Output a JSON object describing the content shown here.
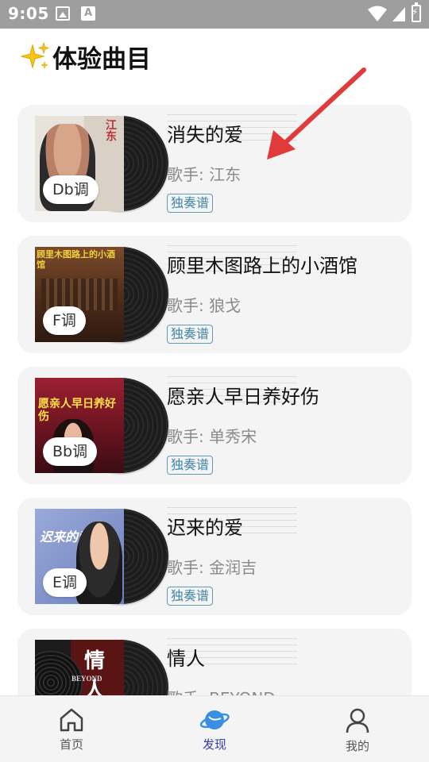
{
  "status_bar": {
    "time": "9:05",
    "a_icon": "A"
  },
  "header": {
    "title": "体验曲目",
    "icon": "sparkle-icon"
  },
  "songs": [
    {
      "title": "消失的爱",
      "artist": "歌手: 江东",
      "key": "Db调",
      "tag": "独奏谱",
      "cover": {
        "bg": "#e8e4dc",
        "text": "江东",
        "text_color": "#b33"
      }
    },
    {
      "title": "顾里木图路上的小酒馆",
      "artist": "歌手: 狼戈",
      "key": "F调",
      "tag": "独奏谱",
      "cover": {
        "bg": "#6b3b22",
        "text": "顾里木图路上的小酒馆",
        "text_color": "#f2d03b"
      }
    },
    {
      "title": "愿亲人早日养好伤",
      "artist": "歌手: 单秀宋",
      "key": "Bb调",
      "tag": "独奏谱",
      "cover": {
        "bg": "#8a1f2a",
        "text": "愿亲人早日养好伤",
        "text_color": "#ffe04a"
      }
    },
    {
      "title": "迟来的爱",
      "artist": "歌手: 金润吉",
      "key": "E调",
      "tag": "独奏谱",
      "cover": {
        "bg": "#7b8fc7",
        "text": "迟来的爱",
        "text_color": "#ffffff"
      }
    },
    {
      "title": "情人",
      "artist": "歌手: BEYOND",
      "key": "",
      "tag": "",
      "cover": {
        "bg": "#2a1414",
        "text": "情人",
        "text_color": "#ffffff",
        "sub": "BEYOND"
      }
    }
  ],
  "nav": {
    "items": [
      {
        "label": "首页",
        "icon": "home-icon"
      },
      {
        "label": "发现",
        "icon": "planet-icon",
        "active": true
      },
      {
        "label": "我的",
        "icon": "user-icon"
      }
    ]
  },
  "colors": {
    "accent": "#3b3bb0",
    "tag": "#3f86a8",
    "card_bg": "#f4f4f4",
    "arrow": "#e03a3a"
  }
}
